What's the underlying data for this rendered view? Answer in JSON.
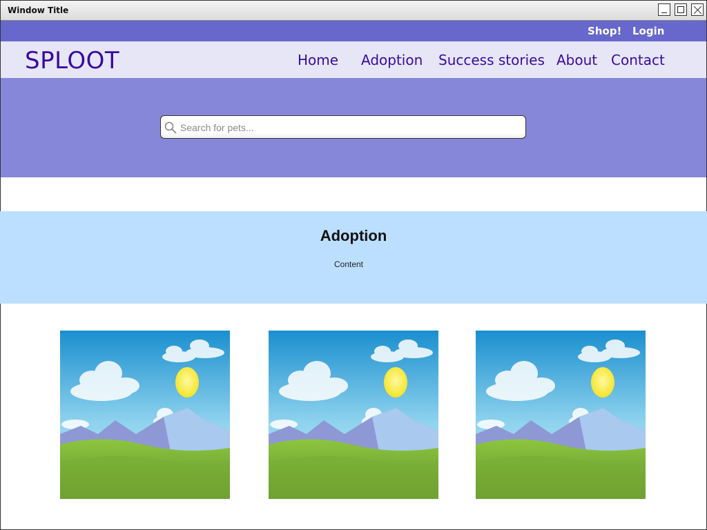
{
  "window": {
    "title": "Window Title"
  },
  "topbar": {
    "shop_label": "Shop!",
    "login_label": "Login"
  },
  "brand": {
    "logo": "SPLOOT"
  },
  "nav": {
    "items": [
      {
        "label": "Home"
      },
      {
        "label": "Adoption"
      },
      {
        "label": "Success stories"
      },
      {
        "label": "About"
      },
      {
        "label": "Contact"
      }
    ]
  },
  "search": {
    "placeholder": "Search for pets...",
    "value": "",
    "icon": "search-icon"
  },
  "section": {
    "title": "Adoption",
    "content": "Content"
  },
  "gallery": {
    "items": [
      {
        "icon": "landscape-image-placeholder"
      },
      {
        "icon": "landscape-image-placeholder"
      },
      {
        "icon": "landscape-image-placeholder"
      }
    ]
  },
  "colors": {
    "topbar": "#6767cc",
    "navbar": "#e6e6f6",
    "hero": "#8787d9",
    "band": "#bcdfff",
    "brand_text": "#3a0aa0"
  }
}
